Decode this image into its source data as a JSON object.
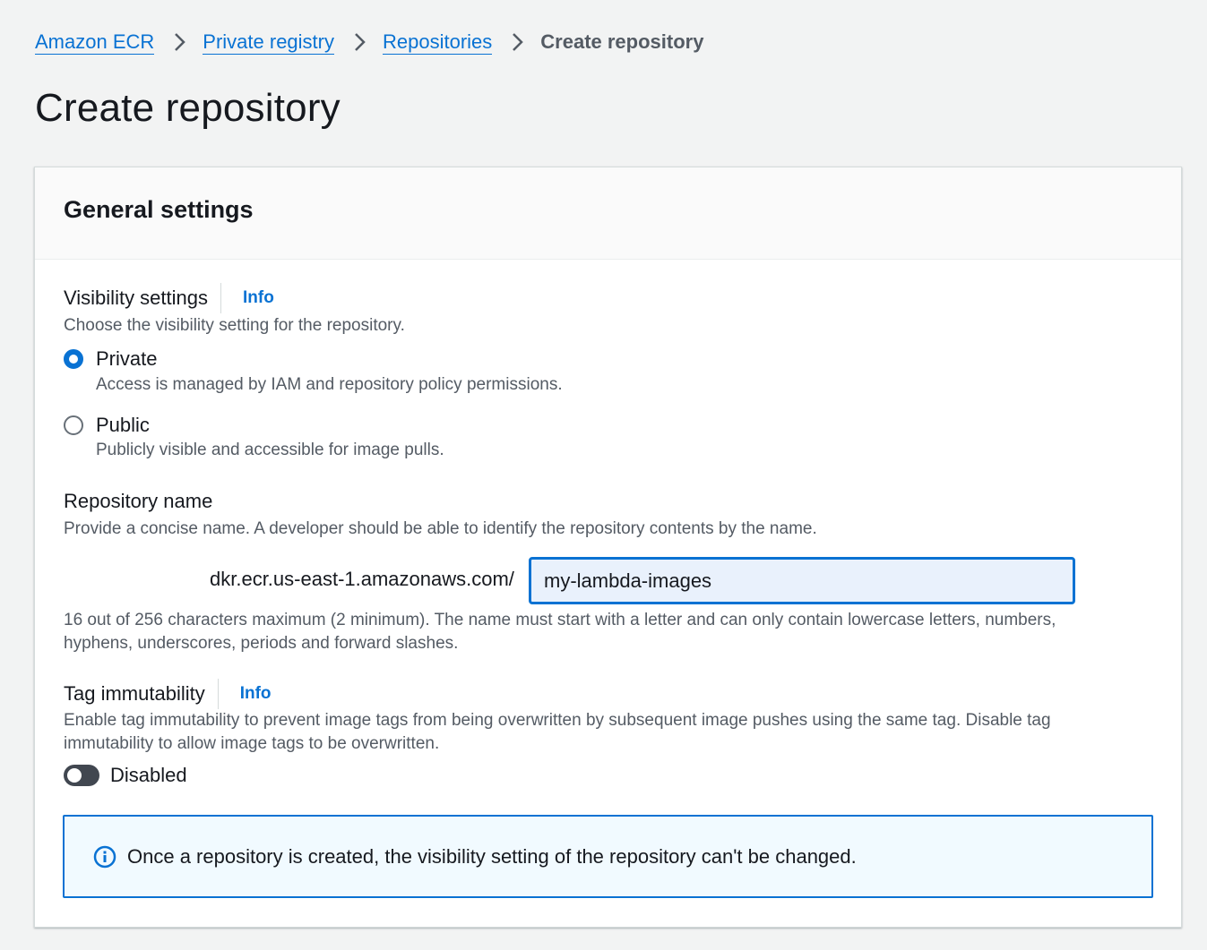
{
  "breadcrumb": {
    "items": [
      "Amazon ECR",
      "Private registry",
      "Repositories"
    ],
    "current": "Create repository"
  },
  "page": {
    "title": "Create repository"
  },
  "general_settings": {
    "title": "General settings",
    "visibility": {
      "label": "Visibility settings",
      "info": "Info",
      "description": "Choose the visibility setting for the repository.",
      "selected": "Private",
      "options": [
        {
          "label": "Private",
          "description": "Access is managed by IAM and repository policy permissions."
        },
        {
          "label": "Public",
          "description": "Publicly visible and accessible for image pulls."
        }
      ]
    },
    "repository_name": {
      "label": "Repository name",
      "description": "Provide a concise name. A developer should be able to identify the repository contents by the name.",
      "prefix": "dkr.ecr.us-east-1.amazonaws.com/",
      "value": "my-lambda-images",
      "constraint_line1": "16 out of 256 characters maximum (2 minimum). The name must start with a letter and can only contain lowercase letters, numbers,",
      "constraint_line2": "hyphens, underscores, periods and forward slashes."
    },
    "tag_immutability": {
      "label": "Tag immutability",
      "info": "Info",
      "description_line1": "Enable tag immutability to prevent image tags from being overwritten by subsequent image pushes using the same tag. Disable tag",
      "description_line2": "immutability to allow image tags to be overwritten.",
      "toggle_label": "Disabled",
      "enabled": false
    },
    "alert": {
      "icon": "info-circle-icon",
      "text": "Once a repository is created, the visibility setting of the repository can't be changed."
    }
  },
  "colors": {
    "link": "#0972d3",
    "background": "#f2f3f3",
    "text": "#16191f",
    "secondary_text": "#545b64"
  }
}
